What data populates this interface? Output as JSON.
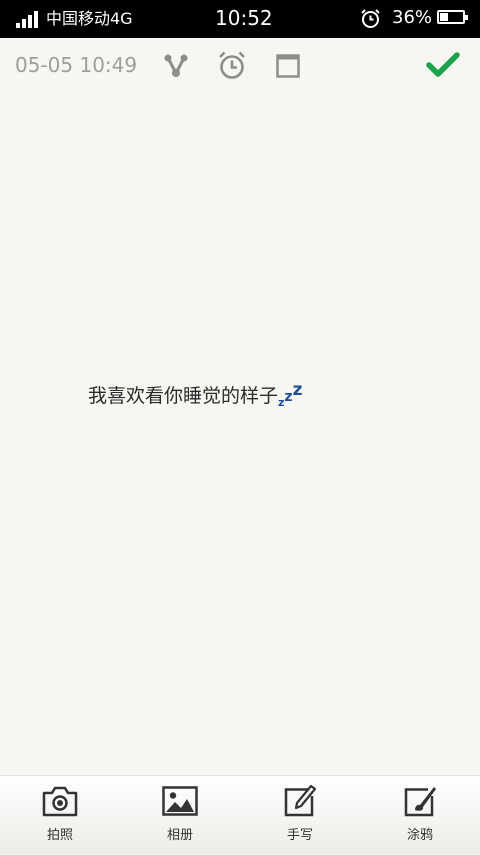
{
  "status_bar": {
    "carrier": "中国移动4G",
    "time": "10:52",
    "battery_percent": "36%",
    "battery_level": 0.36,
    "signal_bars": 4
  },
  "toolbar": {
    "date": "05-05 10:49",
    "icons": [
      "share-icon",
      "alarm-icon",
      "note-color-icon",
      "checkmark-icon"
    ],
    "done_color": "#1aa34a",
    "icon_color": "#8d8d89"
  },
  "note": {
    "text": "我喜欢看你睡觉的样子",
    "emoji": [
      "z",
      "z",
      "z"
    ],
    "emoji_color": "#1f4e9a"
  },
  "bottom_bar": {
    "items": [
      {
        "label": "拍照",
        "icon": "camera-icon"
      },
      {
        "label": "相册",
        "icon": "gallery-icon"
      },
      {
        "label": "手写",
        "icon": "handwrite-icon"
      },
      {
        "label": "涂鸦",
        "icon": "doodle-icon"
      }
    ]
  }
}
